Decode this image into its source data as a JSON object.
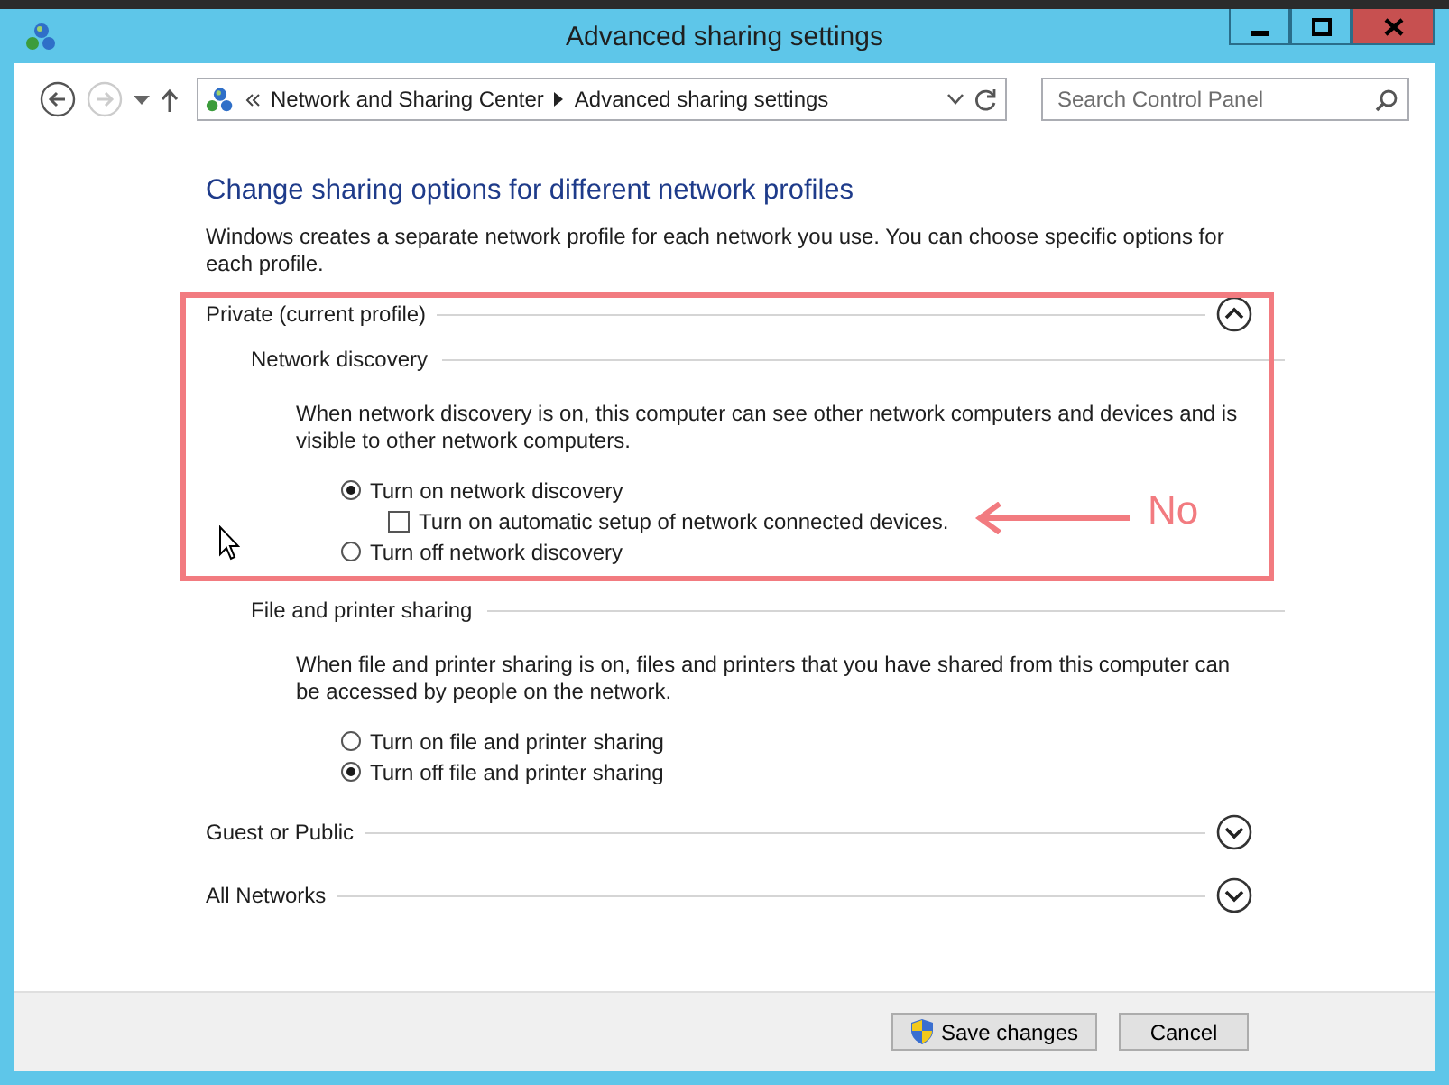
{
  "window": {
    "title": "Advanced sharing settings"
  },
  "address": {
    "crumbs": [
      "Network and Sharing Center",
      "Advanced sharing settings"
    ]
  },
  "search": {
    "placeholder": "Search Control Panel"
  },
  "heading": "Change sharing options for different network profiles",
  "intro": "Windows creates a separate network profile for each network you use. You can choose specific options for each profile.",
  "profiles": [
    {
      "label": "Private (current profile)",
      "expanded": true,
      "groups": [
        {
          "title": "Network discovery",
          "description": "When network discovery is on, this computer can see other network computers and devices and is visible to other network computers.",
          "options": [
            {
              "kind": "radio",
              "label": "Turn on network discovery",
              "selected": true,
              "children": [
                {
                  "kind": "checkbox",
                  "label": "Turn on automatic setup of network connected devices.",
                  "checked": false
                }
              ]
            },
            {
              "kind": "radio",
              "label": "Turn off network discovery",
              "selected": false
            }
          ]
        },
        {
          "title": "File and printer sharing",
          "description": "When file and printer sharing is on, files and printers that you have shared from this computer can be accessed by people on the network.",
          "options": [
            {
              "kind": "radio",
              "label": "Turn on file and printer sharing",
              "selected": false
            },
            {
              "kind": "radio",
              "label": "Turn off file and printer sharing",
              "selected": true
            }
          ]
        }
      ]
    },
    {
      "label": "Guest or Public",
      "expanded": false
    },
    {
      "label": "All Networks",
      "expanded": false
    }
  ],
  "annotation": {
    "text": "No"
  },
  "buttons": [
    {
      "label": "Save changes",
      "kind": "shield"
    },
    {
      "label": "Cancel",
      "kind": "plain"
    }
  ]
}
